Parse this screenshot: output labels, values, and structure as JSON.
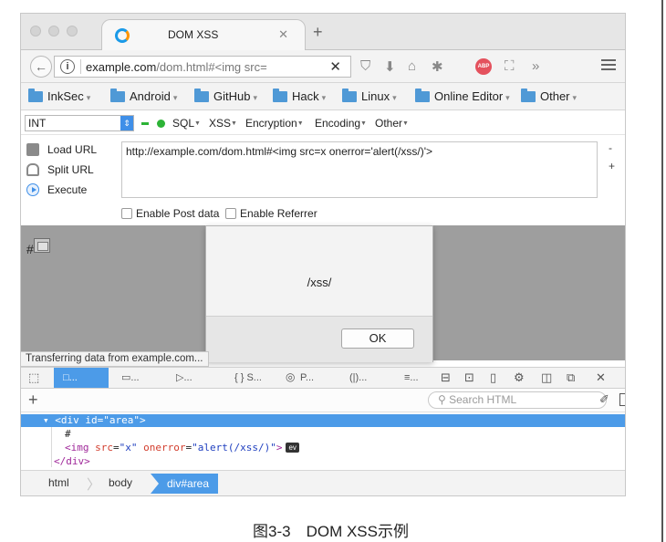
{
  "tab": {
    "title": "DOM XSS"
  },
  "navbar": {
    "url_host": "example.com",
    "url_path": "/dom.html#<img src="
  },
  "bookmarks": [
    {
      "label": "InkSec"
    },
    {
      "label": "Android"
    },
    {
      "label": "GitHub"
    },
    {
      "label": "Hack"
    },
    {
      "label": "Linux"
    },
    {
      "label": "Online Editor"
    },
    {
      "label": "Other"
    }
  ],
  "hackbar": {
    "select_value": "INT",
    "menus": [
      "SQL",
      "XSS",
      "Encryption",
      "Encoding",
      "Other"
    ],
    "actions": [
      "Load URL",
      "Split URL",
      "Execute"
    ],
    "url_value": "http://example.com/dom.html#<img src=x onerror='alert(/xss/)'>",
    "minus": "-",
    "plus": "+",
    "enable_post": "Enable Post data",
    "enable_referrer": "Enable Referrer"
  },
  "page": {
    "hash": "#"
  },
  "dialog": {
    "message": "/xss/",
    "ok_label": "OK"
  },
  "status_text": "Transferring data from example.com...",
  "devtools": {
    "tabs": [
      "□...",
      "▭...",
      "▷...",
      "{ } S...",
      "P...",
      "(|)...",
      "≡..."
    ],
    "add": "+",
    "search_placeholder": "Search HTML",
    "tree": {
      "line1": {
        "prefix": "<",
        "tag_open": "div",
        "attr": "id",
        "eq": "=",
        "val": "\"area\"",
        "suffix": ">"
      },
      "line2": "#",
      "line3": {
        "prefix": "<",
        "tag": "img",
        "attr1": "src",
        "val1": "\"x\"",
        "attr2": "onerror",
        "val2": "\"alert(/xss/)\"",
        "suffix": ">",
        "badge": "ev"
      },
      "line4": {
        "prefix": "</",
        "tag": "div",
        "suffix": ">"
      }
    },
    "breadcrumbs": [
      "html",
      "body",
      "div#area"
    ]
  },
  "caption": "图3-3　DOM XSS示例"
}
